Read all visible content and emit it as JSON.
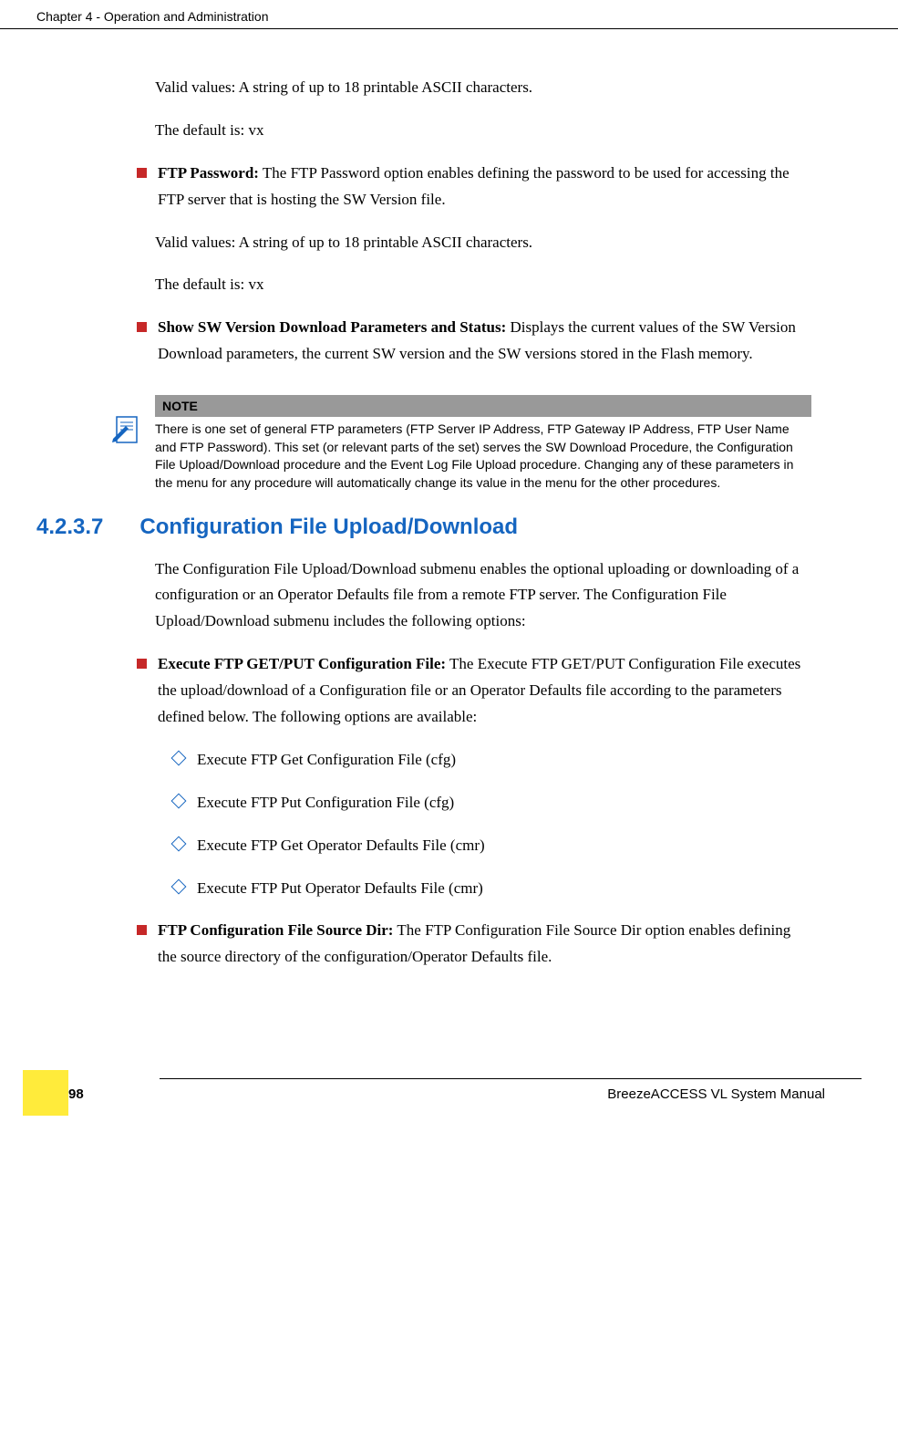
{
  "header": {
    "chapter": "Chapter 4 - Operation and Administration"
  },
  "paragraphs": {
    "valid_values_1": "Valid values: A string of up to 18 printable ASCII characters.",
    "default_1": "The default is: vx",
    "ftp_password_label": "FTP Password:",
    "ftp_password_text": " The FTP Password option enables defining the password to be used for accessing the FTP server that is hosting the SW Version file.",
    "valid_values_2": "Valid values: A string of up to 18 printable ASCII characters.",
    "default_2": "The default is: vx",
    "show_sw_label": "Show SW Version Download Parameters and Status:",
    "show_sw_text": " Displays the current values of the SW Version Download parameters, the current SW version and the SW versions stored in the Flash memory."
  },
  "note": {
    "header": "NOTE",
    "body": "There is one set of general FTP parameters (FTP Server IP Address, FTP Gateway IP Address, FTP User Name and FTP Password). This set (or relevant parts of the set) serves the SW Download Procedure, the Configuration File Upload/Download procedure and the Event Log File Upload procedure. Changing any of these parameters in the menu for any procedure will automatically change its value in the menu for the other procedures."
  },
  "section": {
    "number": "4.2.3.7",
    "title": "Configuration File Upload/Download",
    "intro": "The Configuration File Upload/Download submenu enables the optional uploading or downloading of a configuration or an Operator Defaults file from a remote FTP server. The Configuration File Upload/Download submenu includes the following options:"
  },
  "execute_ftp": {
    "label": "Execute FTP GET/PUT Configuration File:",
    "text": " The Execute FTP GET/PUT Configuration File executes the upload/download of a Configuration file or an Operator Defaults file according to the parameters defined below. The following options are available:",
    "sub1": "Execute FTP Get Configuration File (cfg)",
    "sub2": "Execute FTP Put Configuration File (cfg)",
    "sub3": "Execute FTP Get Operator Defaults File (cmr)",
    "sub4": "Execute FTP Put Operator Defaults File (cmr)"
  },
  "ftp_source": {
    "label": "FTP Configuration File Source Dir:",
    "text": " The FTP Configuration File Source Dir option enables defining the source directory of the configuration/Operator Defaults file."
  },
  "footer": {
    "manual": "BreezeACCESS VL System Manual",
    "page": "98"
  }
}
